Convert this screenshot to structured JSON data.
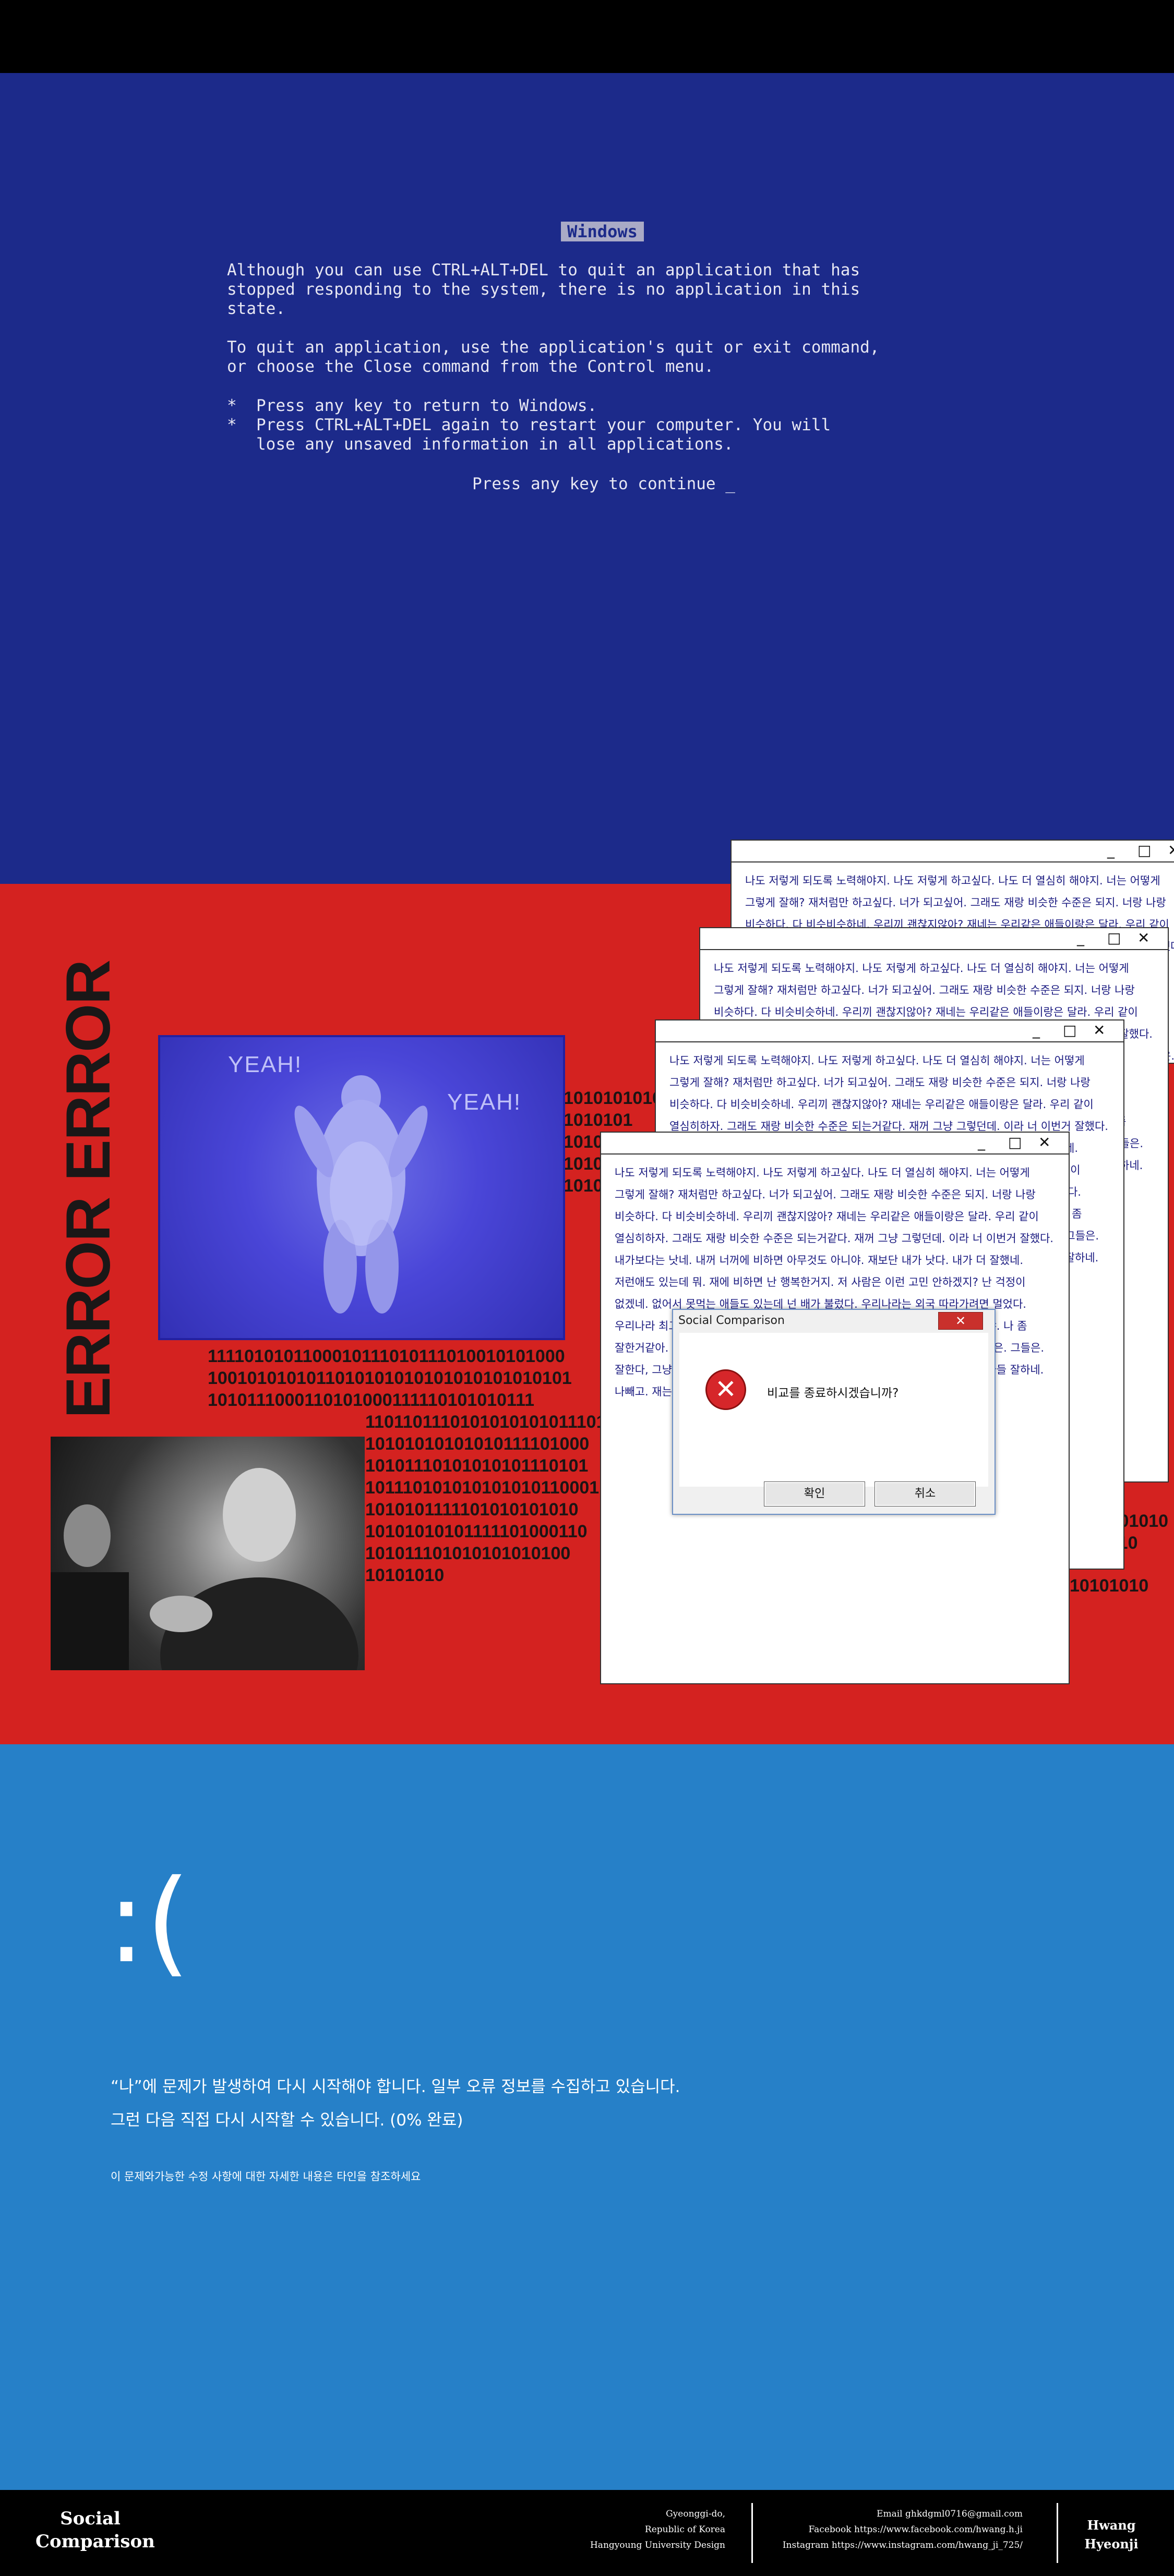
{
  "bsod": {
    "title": "Windows",
    "lines": [
      "Although you can use CTRL+ALT+DEL to quit an application that has",
      "stopped responding to the system, there is no application in this",
      "state.",
      "To quit an application, use the application's quit or exit command,",
      "or choose the Close command from the Control menu.",
      "*  Press any key to return to Windows.",
      "*  Press CTRL+ALT+DEL again to restart your computer. You will",
      "   lose any unsaved information in all applications."
    ],
    "continue": "Press any key to continue _"
  },
  "red": {
    "vertical_title": "ERROR ERROR",
    "yeti": {
      "left_text": "YEAH!",
      "right_text": "YEAH!"
    },
    "binary": [
      "1010101010",
      "1010101",
      "1010100",
      "10101",
      "1010101",
      "1111010101100010111010111010010101000",
      "1001010101011010101010101010101010101",
      "1010111000110101000111110101010111",
      "110110111010101010101110101",
      "10101010101010111101000",
      "10101110101010101110101",
      "101110101010101010110001",
      "1010101111101010101010",
      "10101010101111101000110",
      "101011101010101010100",
      "10101010",
      "1010101010",
      "1101010",
      "10101010"
    ]
  },
  "windows": {
    "controls": {
      "min": "_",
      "max": "□",
      "close": "✕"
    },
    "text": "나도 저렇게 되도록 노력해야지. 나도 저렇게 하고싶다. 나도 더 열심히 해야지. 너는 어떻게 그렇게 잘해? 재처럼만 하고싶다. 너가 되고싶어. 그래도 재랑 비슷한 수준은 되지. 너랑 나랑 비슷하다. 다 비슷비슷하네. 우리끼 괜찮지않아? 재네는 우리같은 애들이랑은 달라. 우리 같이 열심히하자. 그래도 재랑 비슷한 수준은 되는거같다. 재꺼 그냥 그렇던데. 이라 너 이번거 잘했다. 내가보다는 낫네. 내꺼 너꺼에 비하면 아무것도 아니야. 재보단 내가 낫다. 내가 더 잘했네. 저런애도 있는데 뭐. 재에 비하면 난 행복한거지. 저 사람은 이런 고민 안하겠지? 난 걱정이 없겠네. 없어서 못먹는 애들도 있는데 넌 배가 불렀다. 우리나라는 외국 따라가려면 멀었다. 우리나라 최고 태생부터가 달라. 나도 할 수 있어. 난 할 수 없어. 난 아무것도 아니야. 나 좀 잘한거같아. 그사세. 그들만의 리그. 너는, 나는, 우리는, 재는. 저 사람은. 저 사람들은. 그들은. 잘한다, 그냥 그렇네, 별로야, 의외네, 초조해져, 불안해. 나만 제대로 못하는건가. 다들 잘하네. 나빼고. 재는 좀.., 에이 니가 낫다, 내가 낫지?"
  },
  "dialog": {
    "title": "Social Comparison",
    "close": "✕",
    "message": "비교를 종료하시겠습니까?",
    "ok": "확인",
    "cancel": "취소"
  },
  "blue2": {
    "face": ":(",
    "line1": "“나”에 문제가 발생하여 다시 시작해야 합니다. 일부 오류 정보를 수집하고 있습니다.",
    "line2": "그런 다음 직접 다시 시작할 수 있습니다. (0% 완료)",
    "line3": "이 문제와가능한 수정 사항에 대한 자세한 내용은 타인을 참조하세요"
  },
  "footer": {
    "title_line1": "Social",
    "title_line2": "Comparison",
    "loc1": "Gyeonggi-do,",
    "loc2": "Republic of Korea",
    "loc3": "Hangyoung University Design",
    "email": "Email ghkdgml0716@gmail.com",
    "facebook": "Facebook https://www.facebook.com/hwang.h.ji",
    "instagram": "Instagram https://www.instagram.com/hwang_ji_725/",
    "name1": "Hwang",
    "name2": "Hyeonji"
  },
  "colors": {
    "bsod_bg": "#1c2a8a",
    "red_bg": "#d42220",
    "blue_bg": "#2680c8",
    "footer_bg": "#000000"
  }
}
